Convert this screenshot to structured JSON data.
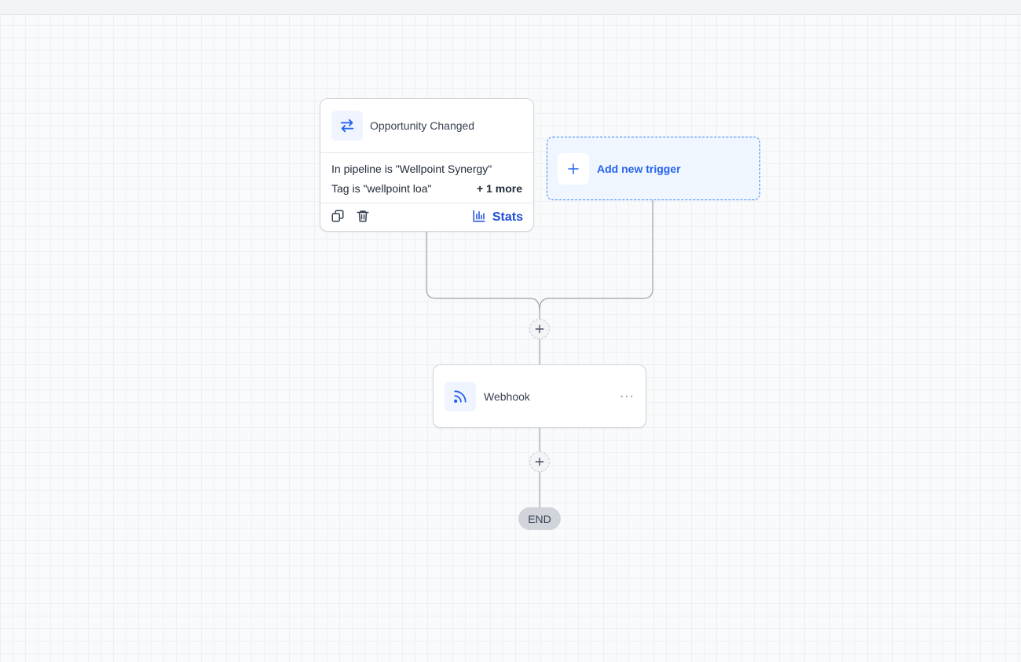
{
  "trigger": {
    "title": "Opportunity Changed",
    "icon": "arrows-swap-icon",
    "conditions": [
      "In pipeline is \"Wellpoint Synergy\"",
      "Tag is \"wellpoint loa\""
    ],
    "more_label": "+ 1 more",
    "stats_label": "Stats"
  },
  "add_trigger": {
    "label": "Add new trigger"
  },
  "action": {
    "title": "Webhook",
    "icon": "rss-feed-icon",
    "menu": "···"
  },
  "end": {
    "label": "END"
  },
  "colors": {
    "accent": "#2563eb",
    "icon_bg": "#eff4ff",
    "dashed_border": "#3b82f6"
  }
}
